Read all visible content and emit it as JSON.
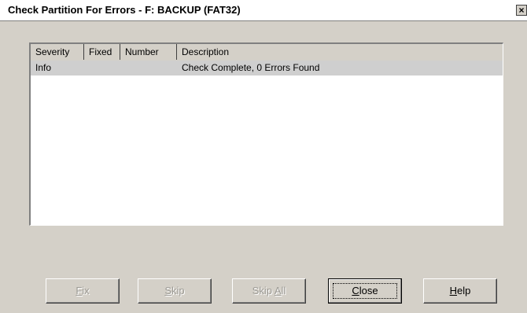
{
  "window": {
    "title": "Check Partition For Errors - F: BACKUP (FAT32)",
    "close_glyph": "×"
  },
  "list": {
    "columns": [
      "Severity",
      "Fixed",
      "Number",
      "Description"
    ],
    "rows": [
      {
        "severity": "Info",
        "fixed": "",
        "number": "",
        "description": "Check Complete, 0 Errors Found"
      }
    ]
  },
  "buttons": [
    {
      "pre": "",
      "mnemonic": "F",
      "post": "ix",
      "enabled": false
    },
    {
      "pre": "",
      "mnemonic": "S",
      "post": "kip",
      "enabled": false
    },
    {
      "pre": "Skip ",
      "mnemonic": "A",
      "post": "ll",
      "enabled": false
    },
    {
      "pre": "",
      "mnemonic": "C",
      "post": "lose",
      "enabled": true,
      "default": true
    },
    {
      "pre": "",
      "mnemonic": "H",
      "post": "elp",
      "enabled": true
    }
  ]
}
